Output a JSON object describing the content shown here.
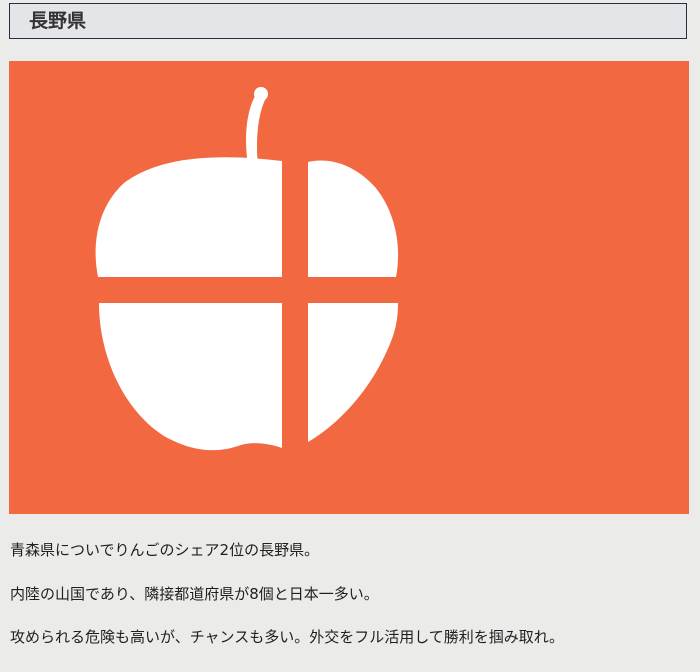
{
  "page": {
    "heading": "長野県"
  },
  "flag": {
    "background_color": "#f26841",
    "emblem_color": "#ffffff",
    "emblem_icon": "apple-cross-emblem"
  },
  "paragraphs": {
    "p1": "青森県についでりんごのシェア2位の長野県。",
    "p2": "内陸の山国であり、隣接都道府県が8個と日本一多い。",
    "p3": "攻められる危険も高いが、チャンスも多い。外交をフル活用して勝利を掴み取れ。"
  }
}
